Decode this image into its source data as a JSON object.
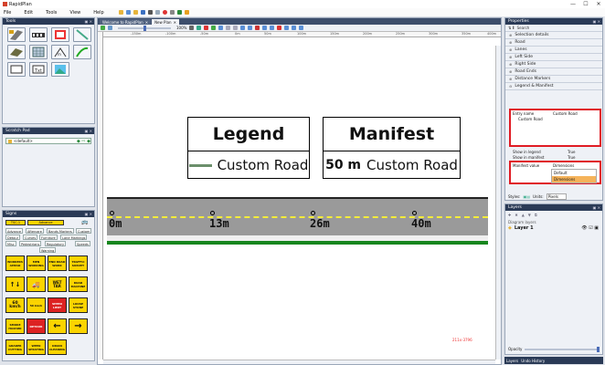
{
  "window": {
    "title": "RapidPlan",
    "min": "—",
    "max": "☐",
    "close": "✕"
  },
  "menu": [
    "File",
    "Edit",
    "Tools",
    "View",
    "Help"
  ],
  "tools_panel": {
    "title": "Tools"
  },
  "scratch_panel": {
    "title": "Scratch Pad",
    "item": "<default>"
  },
  "signs_panel": {
    "title": "Signs",
    "tsc_label": "TSC-1",
    "advance_label": "Advance",
    "tabs_row1": [
      "Advance",
      "Aftercare",
      "Bands Markers",
      "Custom"
    ],
    "tabs_row2": [
      "Detour",
      "Curves",
      "Furniture",
      "Lane Markings"
    ],
    "tabs_row3": [
      "Misc",
      "Pedestrians",
      "Regulatory",
      "Speeds"
    ],
    "tabs_row4": [
      "Warning"
    ],
    "signs": [
      "WORKERS AHEAD",
      "MEN WORKING",
      "END ROAD WORK",
      "TRAFFIC SURVEY",
      "↑↓",
      "🚚",
      "WET TAR",
      "ROAD MACHINE",
      "60 km/h",
      "50 km/h",
      "SPEED LIMIT",
      "LOOSE STONE",
      "SMOKE HAZARD",
      "DETOUR",
      "←",
      "→",
      "GRADER CUTTING",
      "WEED SPRAYING",
      "DRAIN CLEANING"
    ]
  },
  "canvas": {
    "tabs": [
      "Welcome to RapidPlan",
      "New Plan"
    ],
    "zoom": "100%",
    "ruler_top": [
      "-150m",
      "-100m",
      "-50m",
      "0m",
      "50m",
      "100m",
      "150m",
      "200m",
      "250m",
      "300m",
      "350m",
      "400m"
    ],
    "legend_title": "Legend",
    "legend_item": "Custom Road",
    "manifest_title": "Manifest",
    "manifest_qty": "50 m",
    "manifest_item": "Custom Road",
    "chainage": [
      "0m",
      "13m",
      "26m",
      "40m"
    ],
    "coords": "211x-3796"
  },
  "properties": {
    "title": "Properties",
    "search_placeholder": "Search",
    "sections": [
      "Selection details",
      "Road",
      "Lanes",
      "Left Side",
      "Right Side",
      "Road Ends",
      "Distance Markers",
      "Legend & Manifest"
    ],
    "entry_name_label": "Entry name",
    "entry_name_value": "Custom Road",
    "entry_text": "Custom Road",
    "show_legend_label": "Show in legend",
    "show_legend_value": "True",
    "show_manifest_label": "Show in manifest",
    "show_manifest_value": "True",
    "manifest_value_label": "Manifest value",
    "manifest_value_value": "Dimensions",
    "dropdown_options": [
      "Default",
      "Dimensions"
    ],
    "styles_label": "Styles:",
    "units_label": "Units:",
    "units_value": "Pixels"
  },
  "layers": {
    "title": "Layers",
    "diagram_label": "Diagram layers",
    "layer1": "Layer 1",
    "opacity_label": "Opacity"
  },
  "bottom_tabs": [
    "Layers",
    "Undo History"
  ]
}
